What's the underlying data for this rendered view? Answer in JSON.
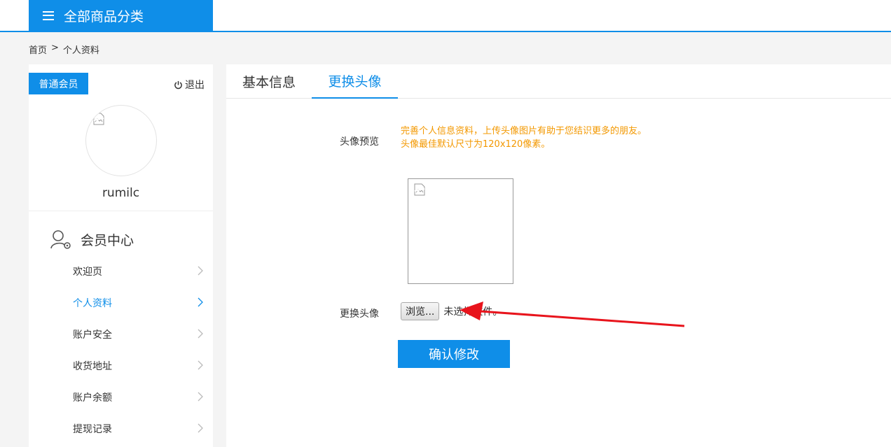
{
  "header": {
    "category_button": "全部商品分类"
  },
  "breadcrumb": {
    "home": "首页",
    "separator": ">",
    "current": "个人资料"
  },
  "sidebar": {
    "member_level": "普通会员",
    "logout": "退出",
    "username": "rumilc",
    "section_title": "会员中心",
    "items": [
      {
        "label": "欢迎页",
        "active": false
      },
      {
        "label": "个人资料",
        "active": true
      },
      {
        "label": "账户安全",
        "active": false
      },
      {
        "label": "收货地址",
        "active": false
      },
      {
        "label": "账户余额",
        "active": false
      },
      {
        "label": "提现记录",
        "active": false
      }
    ]
  },
  "tabs": [
    {
      "label": "基本信息",
      "active": false
    },
    {
      "label": "更换头像",
      "active": true
    }
  ],
  "form": {
    "preview_label": "头像预览",
    "notice_line1": "完善个人信息资料，上传头像图片有助于您结识更多的朋友。",
    "notice_line2": "头像最佳默认尺寸为120x120像素。",
    "change_label": "更换头像",
    "browse_button": "浏览...",
    "no_file_text": "未选择文件。",
    "confirm_button": "确认修改"
  },
  "colors": {
    "brand_blue": "#0f8ee8",
    "notice_orange": "#f39800",
    "annotation_arrow": "#e8141c"
  },
  "icons": {
    "category": "hamburger-icon",
    "logout": "power-icon",
    "member_center": "user-gear-icon",
    "menu_chevron": "chevron-right-icon",
    "image_placeholder": "broken-image-icon"
  }
}
